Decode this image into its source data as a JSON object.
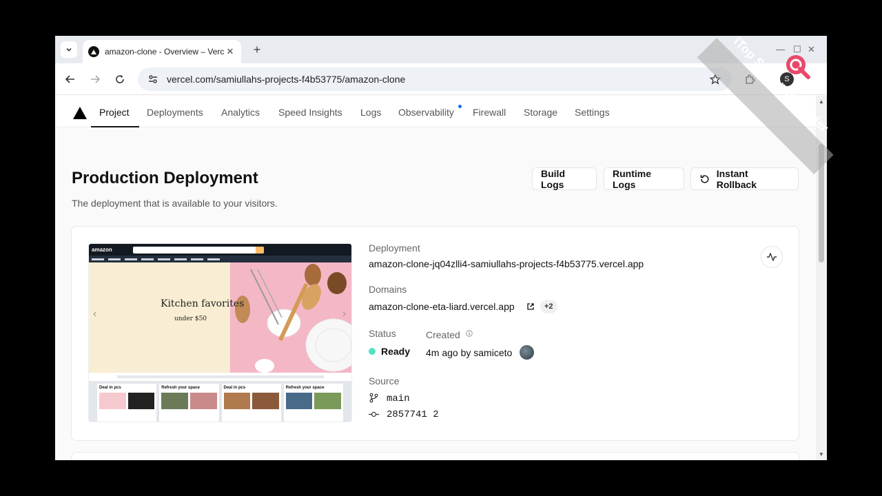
{
  "browser": {
    "tab_title": "amazon-clone - Overview – Vercel",
    "close_glyph": "✕",
    "new_tab_glyph": "+",
    "url": "vercel.com/samiullahs-projects-f4b53775/amazon-clone",
    "profile_initial": "S"
  },
  "nav": {
    "items": [
      "Project",
      "Deployments",
      "Analytics",
      "Speed Insights",
      "Logs",
      "Observability",
      "Firewall",
      "Storage",
      "Settings"
    ],
    "active": "Project"
  },
  "page": {
    "title": "Production Deployment",
    "subtitle": "The deployment that is available to your visitors.",
    "buttons": {
      "build_logs": "Build Logs",
      "runtime_logs": "Runtime Logs",
      "instant_rollback": "Instant Rollback"
    }
  },
  "preview": {
    "logo": "amazon",
    "hero_title": "Kitchen favorites",
    "hero_sub": "under $50",
    "cards": [
      "Deal in pcs",
      "Refresh your space",
      "Deal in pcs",
      "Refresh your space"
    ]
  },
  "deployment": {
    "deployment_label": "Deployment",
    "deployment_url": "amazon-clone-jq04zlli4-samiullahs-projects-f4b53775.vercel.app",
    "domains_label": "Domains",
    "domain": "amazon-clone-eta-liard.vercel.app",
    "domains_extra": "+2",
    "status_label": "Status",
    "status": "Ready",
    "created_label": "Created",
    "created": "4m ago by samiceto",
    "source_label": "Source",
    "branch": "main",
    "commit": "2857741 2"
  },
  "watermark": "iTop Screen Recorder",
  "colors": {
    "status_ready": "#50e3c2",
    "nav_dot": "#0a72ef",
    "amazon_header": "#131921"
  }
}
